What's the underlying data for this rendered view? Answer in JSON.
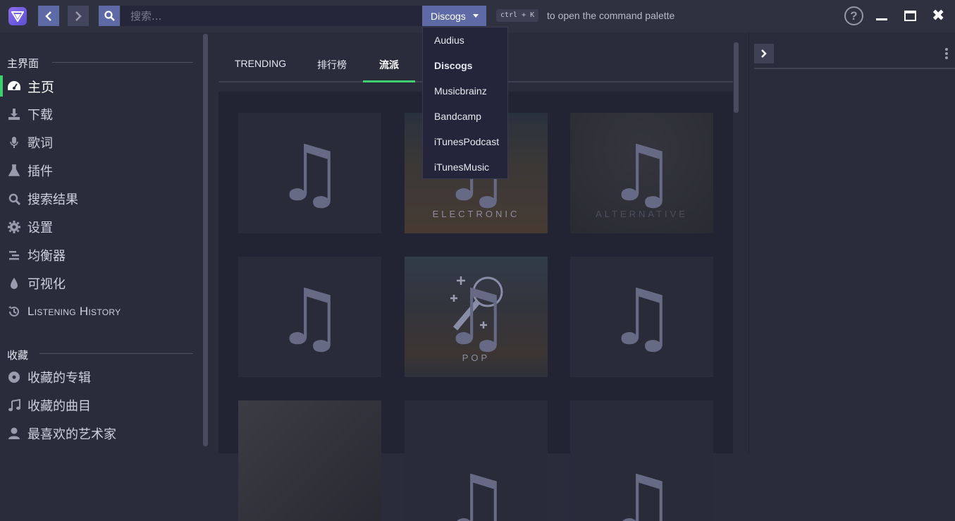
{
  "topbar": {
    "search_placeholder": "搜索...",
    "provider_selected": "Discogs",
    "shortcut": "ctrl + K",
    "command_hint": "to open the command palette"
  },
  "provider_dropdown": {
    "options": [
      "Audius",
      "Discogs",
      "Musicbrainz",
      "Bandcamp",
      "iTunesPodcast",
      "iTunesMusic"
    ]
  },
  "sidebar": {
    "section_main": "主界面",
    "items": [
      {
        "label": "主页",
        "icon": "dashboard-icon"
      },
      {
        "label": "下载",
        "icon": "download-icon"
      },
      {
        "label": "歌词",
        "icon": "microphone-icon"
      },
      {
        "label": "插件",
        "icon": "flask-icon"
      },
      {
        "label": "搜索结果",
        "icon": "search-icon"
      },
      {
        "label": "设置",
        "icon": "gear-icon"
      },
      {
        "label": "均衡器",
        "icon": "equalizer-icon"
      },
      {
        "label": "可视化",
        "icon": "drop-icon"
      },
      {
        "label": "Listening History",
        "icon": "history-icon"
      }
    ],
    "section_favorites": "收藏",
    "favorites": [
      {
        "label": "收藏的专辑",
        "icon": "disc-icon"
      },
      {
        "label": "收藏的曲目",
        "icon": "music-note-icon"
      },
      {
        "label": "最喜欢的艺术家",
        "icon": "user-icon"
      }
    ]
  },
  "main": {
    "tabs": [
      "TRENDING",
      "排行榜",
      "流派"
    ],
    "active_tab": "流派",
    "cards": [
      {
        "genre": ""
      },
      {
        "genre": "ELECTRONIC"
      },
      {
        "genre": "ALTERNATIVE"
      },
      {
        "genre": ""
      },
      {
        "genre": "POP"
      },
      {
        "genre": ""
      }
    ]
  },
  "colors": {
    "accent_green": "#3ecf6e",
    "button_blue": "#5d6aa6",
    "background": "#2b2c3b"
  }
}
